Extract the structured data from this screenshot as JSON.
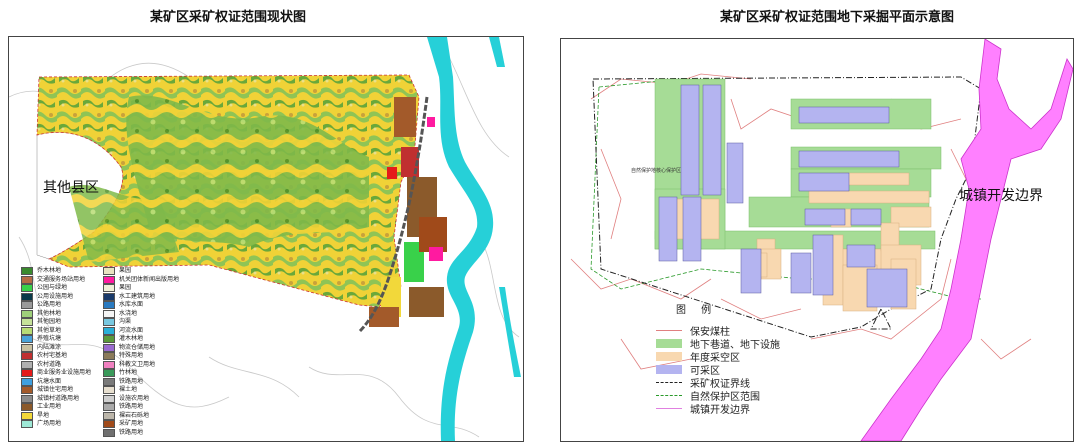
{
  "left_map": {
    "title": "某矿区采矿权证范围现状图",
    "region_label": "其他县区",
    "legend_col1": [
      {
        "label": "乔木林地",
        "color": "#3a8a2e"
      },
      {
        "label": "交通服务场站用地",
        "color": "#b66a45"
      },
      {
        "label": "公园与绿地",
        "color": "#39d14a"
      },
      {
        "label": "公用设施用地",
        "color": "#0a3a4a"
      },
      {
        "label": "公路用地",
        "color": "#9a9a9a"
      },
      {
        "label": "其他林地",
        "color": "#9fd07a"
      },
      {
        "label": "其他园地",
        "color": "#c6e29a"
      },
      {
        "label": "其他草地",
        "color": "#b8dc74"
      },
      {
        "label": "养殖坑塘",
        "color": "#4aa3d8"
      },
      {
        "label": "内陆滩涂",
        "color": "#c9c0a0"
      },
      {
        "label": "农村宅基地",
        "color": "#c03030"
      },
      {
        "label": "农村道路",
        "color": "#b0b0b0"
      },
      {
        "label": "商业服务业设施用地",
        "color": "#e51a1a"
      },
      {
        "label": "坑塘水面",
        "color": "#3fa0e0"
      },
      {
        "label": "城镇住宅用地",
        "color": "#a35a2a"
      },
      {
        "label": "城镇村道路用地",
        "color": "#8c8c8c"
      },
      {
        "label": "工业用地",
        "color": "#8b5a2b"
      },
      {
        "label": "旱地",
        "color": "#f2d83a"
      },
      {
        "label": "广场用地",
        "color": "#9ee8d6"
      }
    ],
    "legend_col2": [
      {
        "label": "果园",
        "color": "#e8e4c0"
      },
      {
        "label": "机关团体新闻出版用地",
        "color": "#ff1aa0"
      },
      {
        "label": "果园",
        "color": "#f0f0d8"
      },
      {
        "label": "水工建筑用地",
        "color": "#1a3a6a"
      },
      {
        "label": "水库水面",
        "color": "#2a7ac0"
      },
      {
        "label": "水浇地",
        "color": "#f5f5f5"
      },
      {
        "label": "沟渠",
        "color": "#79c8e0"
      },
      {
        "label": "河流水面",
        "color": "#2ab0d8"
      },
      {
        "label": "灌木林地",
        "color": "#5a9a3a"
      },
      {
        "label": "物流仓储用地",
        "color": "#9a6ad0"
      },
      {
        "label": "特殊用地",
        "color": "#8a7a5a"
      },
      {
        "label": "科教文卫用地",
        "color": "#f080c0"
      },
      {
        "label": "竹林地",
        "color": "#3a9a5a"
      },
      {
        "label": "铁路用地",
        "color": "#7a7a7a"
      },
      {
        "label": "裸土地",
        "color": "#e8e0d0"
      },
      {
        "label": "设施农用地",
        "color": "#d0d0d0"
      },
      {
        "label": "铁路用地",
        "color": "#aaaaaa"
      },
      {
        "label": "裸岩石砾地",
        "color": "#bcb6aa"
      },
      {
        "label": "采矿用地",
        "color": "#a04a1a"
      },
      {
        "label": "铁路用地",
        "color": "#707070"
      }
    ]
  },
  "right_map": {
    "title": "某矿区采矿权证范围地下采掘平面示意图",
    "region_label": "城镇开发边界",
    "small_label": "自然保护地核心保护区",
    "legend_title": "图 例",
    "legend": [
      {
        "label": "保安煤柱",
        "kind": "line",
        "color": "#e08080"
      },
      {
        "label": "地下巷道、地下设施",
        "kind": "fill",
        "color": "#a6dc96"
      },
      {
        "label": "年度采空区",
        "kind": "fill",
        "color": "#f8d8b0"
      },
      {
        "label": "可采区",
        "kind": "fill",
        "color": "#b4b4f0"
      },
      {
        "label": "采矿权证界线",
        "kind": "dashdot",
        "color": "#222222"
      },
      {
        "label": "自然保护区范围",
        "kind": "dashgreen",
        "color": "#2a9a2a"
      },
      {
        "label": "城镇开发边界",
        "kind": "line",
        "color": "#e080e0"
      }
    ]
  }
}
